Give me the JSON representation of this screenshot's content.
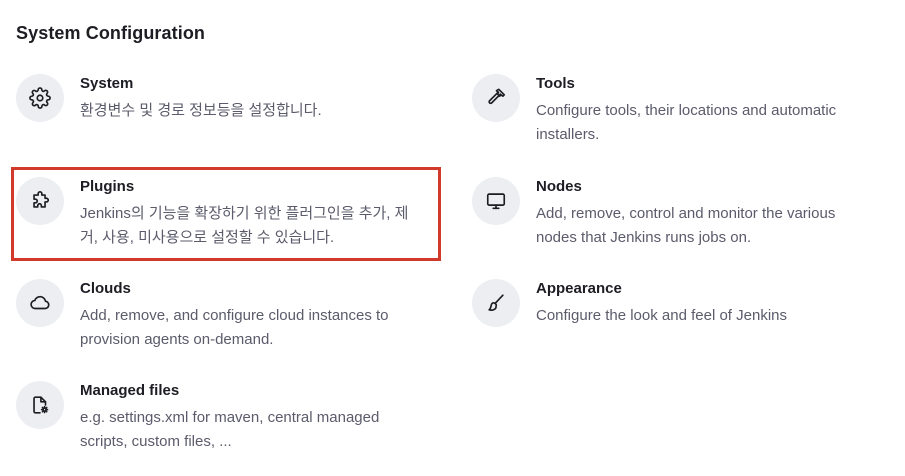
{
  "section": {
    "title": "System Configuration"
  },
  "items": {
    "system": {
      "icon": "gear-icon",
      "title": "System",
      "description": "환경변수 및 경로 정보등을 설정합니다."
    },
    "tools": {
      "icon": "hammer-icon",
      "title": "Tools",
      "description": "Configure tools, their locations and automatic installers."
    },
    "plugins": {
      "icon": "puzzle-icon",
      "title": "Plugins",
      "description": "Jenkins의 기능을 확장하기 위한 플러그인을 추가, 제거, 사용, 미사용으로 설정할 수 있습니다."
    },
    "nodes": {
      "icon": "monitor-icon",
      "title": "Nodes",
      "description": "Add, remove, control and monitor the various nodes that Jenkins runs jobs on."
    },
    "clouds": {
      "icon": "cloud-icon",
      "title": "Clouds",
      "description": "Add, remove, and configure cloud instances to provision agents on-demand."
    },
    "appearance": {
      "icon": "paintbrush-icon",
      "title": "Appearance",
      "description": "Configure the look and feel of Jenkins"
    },
    "managed_files": {
      "icon": "file-gear-icon",
      "title": "Managed files",
      "description": "e.g. settings.xml for maven, central managed scripts, custom files, ..."
    }
  },
  "highlight": {
    "color": "#d13a2b",
    "target": "plugins"
  }
}
